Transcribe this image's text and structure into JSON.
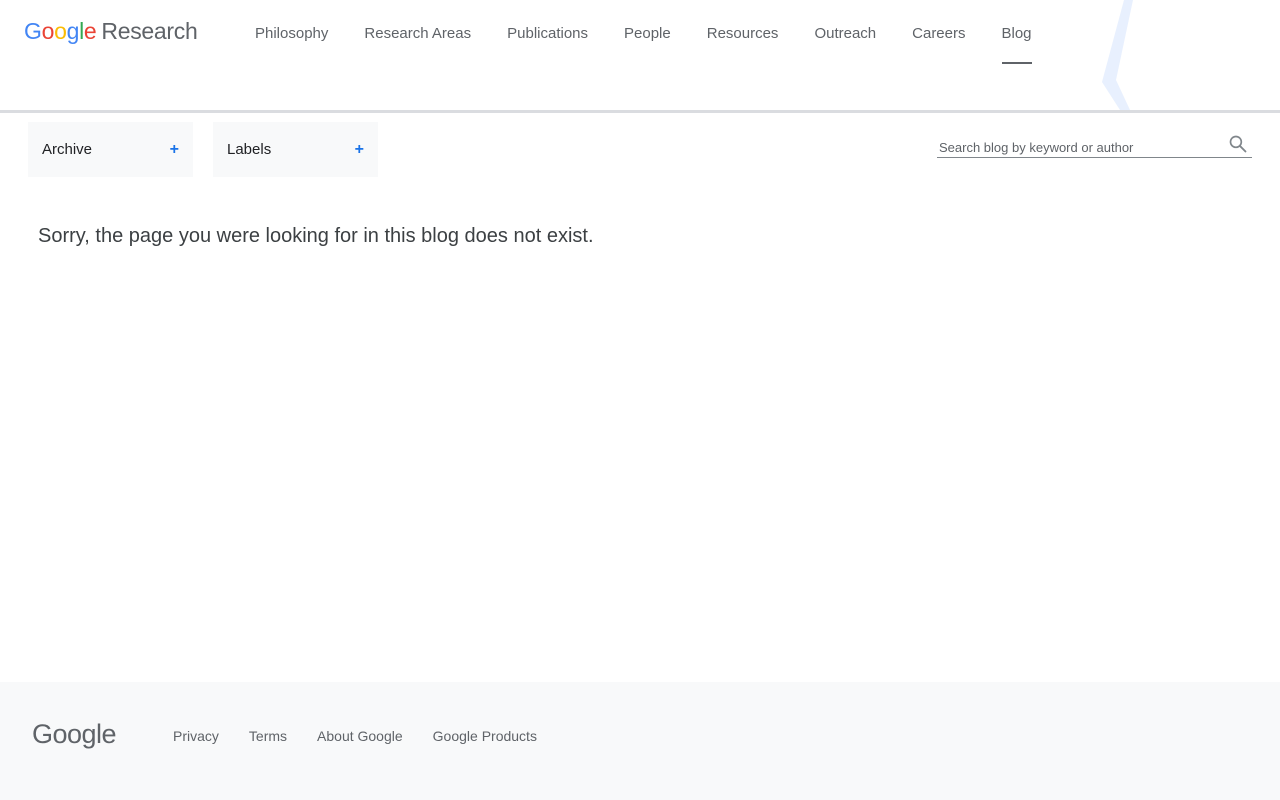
{
  "header": {
    "logo": {
      "letters": [
        "G",
        "o",
        "o",
        "g",
        "l",
        "e"
      ],
      "product": "Research"
    },
    "nav": [
      {
        "label": "Philosophy"
      },
      {
        "label": "Research Areas"
      },
      {
        "label": "Publications"
      },
      {
        "label": "People"
      },
      {
        "label": "Resources"
      },
      {
        "label": "Outreach"
      },
      {
        "label": "Careers"
      },
      {
        "label": "Blog",
        "active": true
      }
    ]
  },
  "filters": {
    "archive": {
      "label": "Archive",
      "toggle": "+"
    },
    "labels": {
      "label": "Labels",
      "toggle": "+"
    }
  },
  "search": {
    "placeholder": "Search blog by keyword or author",
    "value": "",
    "icon": "search-icon"
  },
  "main": {
    "message": "Sorry, the page you were looking for in this blog does not exist."
  },
  "footer": {
    "logo": "Google",
    "links": [
      {
        "label": "Privacy"
      },
      {
        "label": "Terms"
      },
      {
        "label": "About Google"
      },
      {
        "label": "Google Products"
      }
    ]
  },
  "colors": {
    "google_blue": "#4285f4",
    "google_red": "#ea4335",
    "google_yellow": "#fbbc05",
    "google_green": "#34a853",
    "accent": "#1a73e8",
    "footer_bg": "#f8f9fa"
  }
}
